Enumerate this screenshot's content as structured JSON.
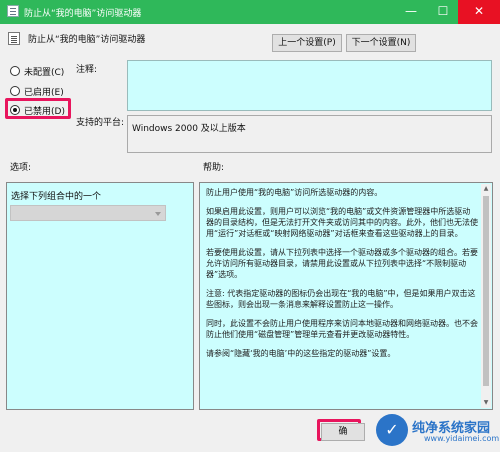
{
  "window": {
    "title": "防止从“我的电脑”访问驱动器",
    "minimize_glyph": "—",
    "maximize_glyph": "☐",
    "close_glyph": "✕",
    "accent_color": "#2fb85a"
  },
  "header": {
    "policy_name": "防止从“我的电脑”访问驱动器",
    "prev_button": "上一个设置(P)",
    "next_button": "下一个设置(N)"
  },
  "state": {
    "options": [
      {
        "label": "未配置(C)",
        "selected": false
      },
      {
        "label": "已启用(E)",
        "selected": false
      },
      {
        "label": "已禁用(D)",
        "selected": true
      }
    ]
  },
  "comment": {
    "label": "注释:",
    "value": ""
  },
  "platform": {
    "label": "支持的平台:",
    "value": "Windows 2000 及以上版本"
  },
  "options_panel": {
    "title": "选项:",
    "combo_label": "选择下列组合中的一个",
    "combo_value": ""
  },
  "help_panel": {
    "title": "帮助:",
    "paragraphs": [
      "防止用户使用“我的电脑”访问所选驱动器的内容。",
      "如果启用此设置，则用户可以浏览“我的电脑”或文件资源管理器中所选驱动器的目录结构，但是无法打开文件夹或访问其中的内容。此外，他们也无法使用“运行”对话框或“映射网络驱动器”对话框来查看这些驱动器上的目录。",
      "若要使用此设置，请从下拉列表中选择一个驱动器或多个驱动器的组合。若要允许访问所有驱动器目录，请禁用此设置或从下拉列表中选择“不限制驱动器”选项。",
      "注意: 代表指定驱动器的图标仍会出现在“我的电脑”中，但是如果用户双击这些图标，则会出现一条消息来解释设置防止这一操作。",
      "同时，此设置不会防止用户使用程序来访问本地驱动器和网络驱动器。也不会防止他们使用“磁盘管理”管理单元查看并更改驱动器特性。",
      "请参阅“隐藏‘我的电脑’中的这些指定的驱动器”设置。"
    ]
  },
  "footer": {
    "ok_button_partial": "确"
  },
  "watermark": {
    "brand": "纯净系统家园",
    "url": "www.yidaimei.com",
    "color": "#2b74c8"
  }
}
